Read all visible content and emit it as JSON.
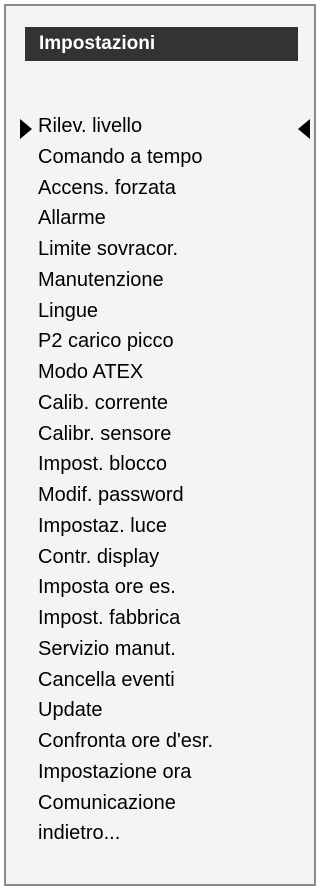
{
  "header": {
    "title": "Impostazioni",
    "background_color": "#333333",
    "text_color": "#ffffff"
  },
  "menu": {
    "selected_index": 0,
    "items": [
      {
        "label": "Rilev. livello"
      },
      {
        "label": "Comando a tempo"
      },
      {
        "label": "Accens. forzata"
      },
      {
        "label": "Allarme"
      },
      {
        "label": "Limite sovracor."
      },
      {
        "label": "Manutenzione"
      },
      {
        "label": "Lingue"
      },
      {
        "label": "P2 carico picco"
      },
      {
        "label": "Modo ATEX"
      },
      {
        "label": "Calib. corrente"
      },
      {
        "label": "Calibr. sensore"
      },
      {
        "label": "Impost. blocco"
      },
      {
        "label": "Modif. password"
      },
      {
        "label": "Impostaz. luce"
      },
      {
        "label": "Contr. display"
      },
      {
        "label": "Imposta ore es."
      },
      {
        "label": "Impost. fabbrica"
      },
      {
        "label": "Servizio manut."
      },
      {
        "label": "Cancella eventi"
      },
      {
        "label": "Update"
      },
      {
        "label": "Confronta ore d'esr."
      },
      {
        "label": "Impostazione ora"
      },
      {
        "label": "Comunicazione"
      },
      {
        "label": "indietro..."
      }
    ]
  },
  "icons": {
    "selection_left": "arrow-right-triangle",
    "selection_right": "arrow-left-triangle"
  }
}
